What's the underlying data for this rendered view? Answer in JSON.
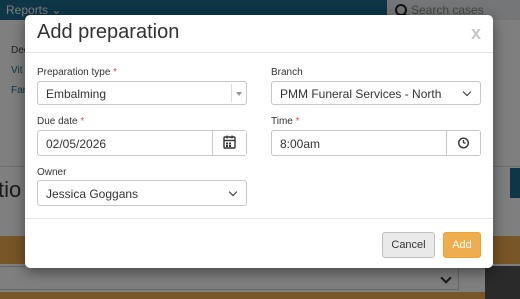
{
  "background": {
    "nav_reports": "Reports",
    "search_placeholder": "Search cases",
    "label_partial": "Dec",
    "link_partial_1": "Vit",
    "link_partial_2": "Far",
    "heading_partial": "tio"
  },
  "modal": {
    "title": "Add preparation",
    "close_glyph": "x",
    "fields": {
      "prep_type": {
        "label": "Preparation type",
        "required": "*",
        "value": "Embalming"
      },
      "branch": {
        "label": "Branch",
        "value": "PMM Funeral Services - North"
      },
      "due_date": {
        "label": "Due date",
        "required": "*",
        "value": "02/05/2026"
      },
      "time": {
        "label": "Time",
        "required": "*",
        "value": "8:00am"
      },
      "owner": {
        "label": "Owner",
        "value": "Jessica Goggans"
      }
    },
    "buttons": {
      "cancel": "Cancel",
      "add": "Add"
    }
  },
  "colors": {
    "accent_orange": "#f0ad4e",
    "nav_blue": "#1c6c8f",
    "required_red": "#d9534f"
  },
  "icons": [
    "search-icon",
    "calendar-icon",
    "clock-icon",
    "chevron-down-icon",
    "close-icon"
  ]
}
